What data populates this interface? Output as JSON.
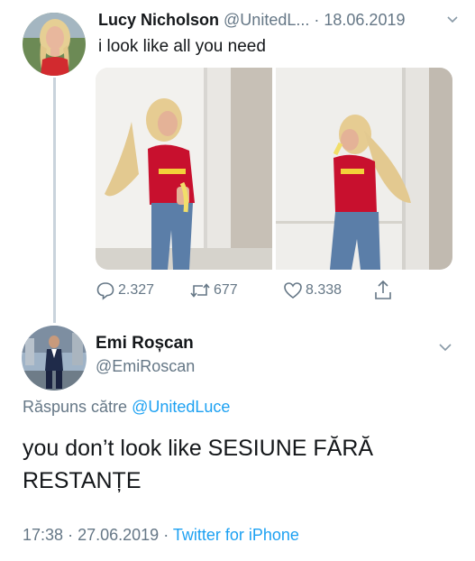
{
  "tweet1": {
    "name": "Lucy Nicholson",
    "handle": "@UnitedL...",
    "separator": "·",
    "date": "18.06.2019",
    "text": "i look like all you need",
    "actions": {
      "reply_count": "2.327",
      "retweet_count": "677",
      "like_count": "8.338"
    },
    "icons": [
      "reply-icon",
      "retweet-icon",
      "like-icon",
      "share-icon",
      "chevron-down-icon"
    ]
  },
  "tweet2": {
    "name": "Emi Roșcan",
    "handle": "@EmiRoscan",
    "reply_prefix": "Răspuns către",
    "reply_mention": "@UnitedLuce",
    "text": "you don’t look like SESIUNE FĂRĂ RESTANȚE",
    "time": "17:38",
    "sep1": "·",
    "date": "27.06.2019",
    "sep2": "·",
    "source": "Twitter for iPhone"
  },
  "colors": {
    "text": "#14171a",
    "muted": "#657786",
    "link": "#1da1f2",
    "thread_line": "#c9d3dc",
    "jersey_red": "#c8102e"
  }
}
